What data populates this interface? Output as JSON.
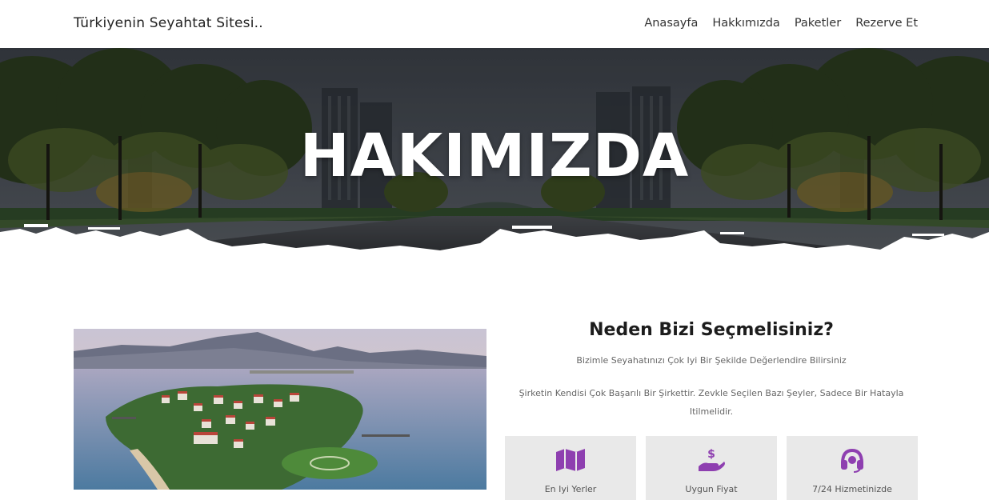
{
  "navbar": {
    "brand": "Türkiyenin Seyahtat Sitesi..",
    "links": [
      "Anasayfa",
      "Hakkımızda",
      "Paketler",
      "Rezerve Et"
    ]
  },
  "hero": {
    "title": "HAKIMIZDA"
  },
  "about": {
    "heading": "Neden Bizi Seçmelisiniz?",
    "subtitle": "Bizimle Seyahatınızı Çok Iyi Bir Şekilde Değerlendire Bilirsiniz",
    "description": "Şirketin Kendisi Çok Başarılı Bir Şirkettir. Zevkle Seçilen Bazı Şeyler, Sadece Bir Hatayla Itilmelidir.",
    "features": [
      {
        "icon": "map-icon",
        "label": "En Iyi Yerler"
      },
      {
        "icon": "hand-money-icon",
        "label": "Uygun Fiyat"
      },
      {
        "icon": "headset-icon",
        "label": "7/24 Hizmetinizde"
      }
    ]
  },
  "colors": {
    "accent": "#8e3fb0",
    "feature_bg": "#e9e9e9"
  }
}
